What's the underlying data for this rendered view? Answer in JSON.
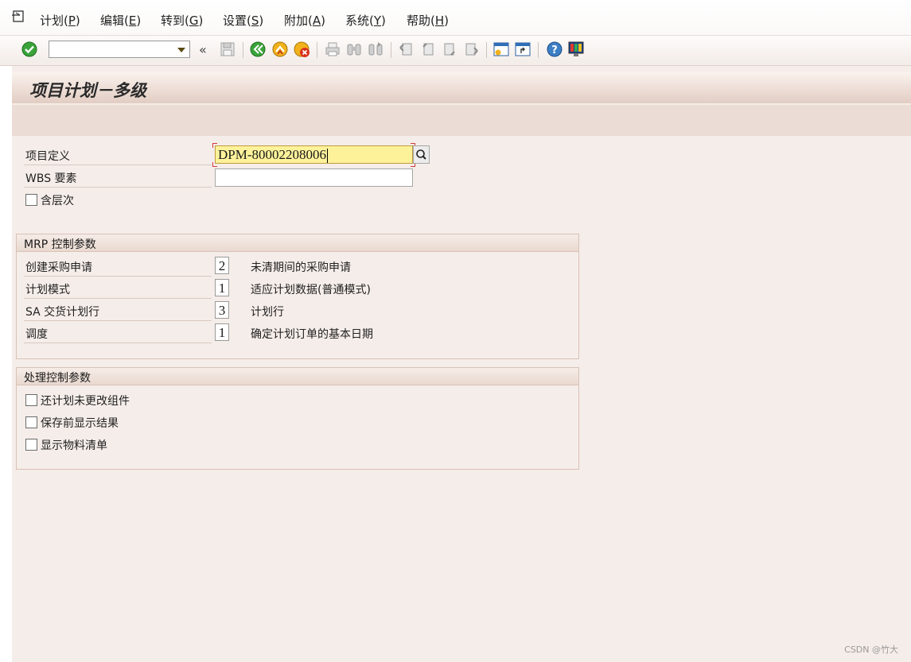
{
  "menu": {
    "items": [
      {
        "label": "计划(",
        "key": "P",
        "tail": ")"
      },
      {
        "label": "编辑(",
        "key": "E",
        "tail": ")"
      },
      {
        "label": "转到(",
        "key": "G",
        "tail": ")"
      },
      {
        "label": "设置(",
        "key": "S",
        "tail": ")"
      },
      {
        "label": "附加(",
        "key": "A",
        "tail": ")"
      },
      {
        "label": "系统(",
        "key": "Y",
        "tail": ")"
      },
      {
        "label": "帮助(",
        "key": "H",
        "tail": ")"
      }
    ]
  },
  "toolbar": {
    "command_value": "",
    "icons": [
      "enter-icon",
      "back-icon",
      "save-icon",
      "green-back-icon",
      "exit-icon",
      "cancel-icon",
      "print-icon",
      "find-icon",
      "find-next-icon",
      "first-page-icon",
      "prev-page-icon",
      "next-page-icon",
      "last-page-icon",
      "new-session-icon",
      "shortcut-icon",
      "help-icon",
      "customize-layout-icon"
    ]
  },
  "title": "项目计划－多级",
  "selection": {
    "project_def_label": "项目定义",
    "project_def_value": "DPM-80002208006",
    "wbs_label": "WBS 要素",
    "wbs_value": "",
    "with_hierarchy_label": "含层次",
    "with_hierarchy_checked": false
  },
  "mrp_group": {
    "title": "MRP 控制参数",
    "rows": [
      {
        "label": "创建采购申请",
        "value": "2",
        "desc": "未清期间的采购申请"
      },
      {
        "label": "计划模式",
        "value": "1",
        "desc": "适应计划数据(普通模式)"
      },
      {
        "label": "SA 交货计划行",
        "value": "3",
        "desc": "计划行"
      },
      {
        "label": "调度",
        "value": "1",
        "desc": "确定计划订单的基本日期"
      }
    ]
  },
  "proc_group": {
    "title": "处理控制参数",
    "options": [
      {
        "label": "还计划未更改组件",
        "checked": false
      },
      {
        "label": "保存前显示结果",
        "checked": false
      },
      {
        "label": "显示物料清单",
        "checked": false
      }
    ]
  },
  "watermark": "CSDN @竹大"
}
